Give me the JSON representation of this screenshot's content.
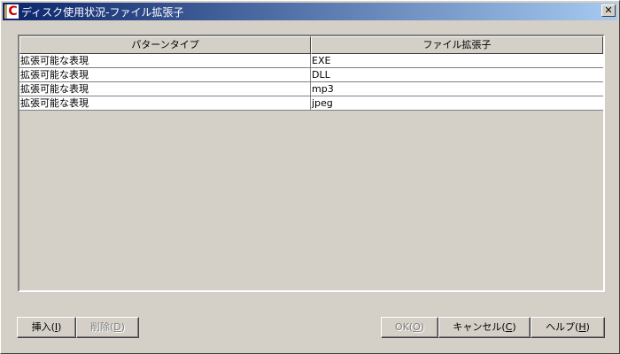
{
  "window": {
    "title": "ディスク使用状況-ファイル拡張子",
    "app_icon_letter": "C",
    "close_label": "✕"
  },
  "table": {
    "headers": [
      "パターンタイプ",
      "ファイル拡張子"
    ],
    "rows": [
      [
        "拡張可能な表現",
        "EXE"
      ],
      [
        "拡張可能な表現",
        "DLL"
      ],
      [
        "拡張可能な表現",
        "mp3"
      ],
      [
        "拡張可能な表現",
        "jpeg"
      ]
    ]
  },
  "buttons": {
    "insert": {
      "label": "挿入(",
      "key": "I",
      "end": ")",
      "enabled": true
    },
    "delete": {
      "label": "削除(",
      "key": "D",
      "end": ")",
      "enabled": false
    },
    "ok": {
      "label": "OK(",
      "key": "O",
      "end": ")",
      "enabled": false
    },
    "cancel": {
      "label": "キャンセル(",
      "key": "C",
      "end": ")",
      "enabled": true
    },
    "help": {
      "label": "ヘルプ(",
      "key": "H",
      "end": ")",
      "enabled": true
    }
  }
}
